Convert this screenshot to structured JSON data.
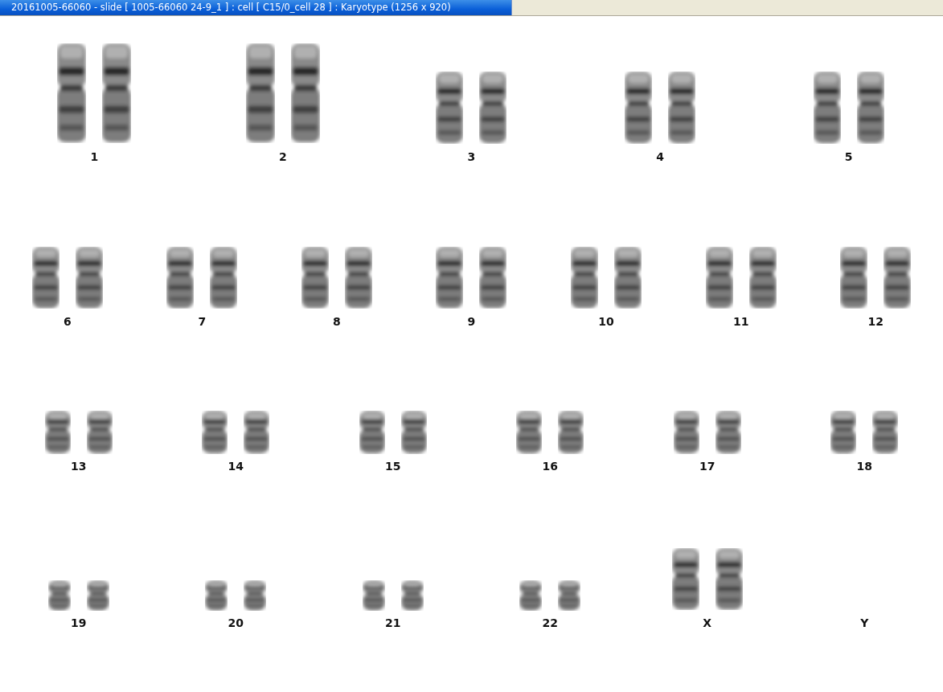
{
  "window": {
    "title": "20161005-66060 - slide [ 1005-66060 24-9_1 ] : cell [ C15/0_cell 28 ] : Karyotype  (1256 x 920)"
  },
  "karyotype_rows": [
    {
      "chromosomes": [
        {
          "label": "1",
          "kind": "large"
        },
        {
          "label": "2",
          "kind": "large"
        },
        {
          "label": "3",
          "kind": "big"
        },
        {
          "label": "4",
          "kind": "big"
        },
        {
          "label": "5",
          "kind": "big"
        }
      ]
    },
    {
      "chromosomes": [
        {
          "label": "6",
          "kind": "medium"
        },
        {
          "label": "7",
          "kind": "medium"
        },
        {
          "label": "8",
          "kind": "medium"
        },
        {
          "label": "9",
          "kind": "medium"
        },
        {
          "label": "10",
          "kind": "medium"
        },
        {
          "label": "11",
          "kind": "medium"
        },
        {
          "label": "12",
          "kind": "medium"
        }
      ]
    },
    {
      "chromosomes": [
        {
          "label": "13",
          "kind": "small"
        },
        {
          "label": "14",
          "kind": "small"
        },
        {
          "label": "15",
          "kind": "small"
        },
        {
          "label": "16",
          "kind": "small"
        },
        {
          "label": "17",
          "kind": "small"
        },
        {
          "label": "18",
          "kind": "small"
        }
      ]
    },
    {
      "chromosomes": [
        {
          "label": "19",
          "kind": "tiny"
        },
        {
          "label": "20",
          "kind": "tiny"
        },
        {
          "label": "21",
          "kind": "tiny"
        },
        {
          "label": "22",
          "kind": "tiny"
        },
        {
          "label": "X",
          "kind": "medium"
        },
        {
          "label": "Y",
          "kind": "none"
        }
      ]
    }
  ]
}
